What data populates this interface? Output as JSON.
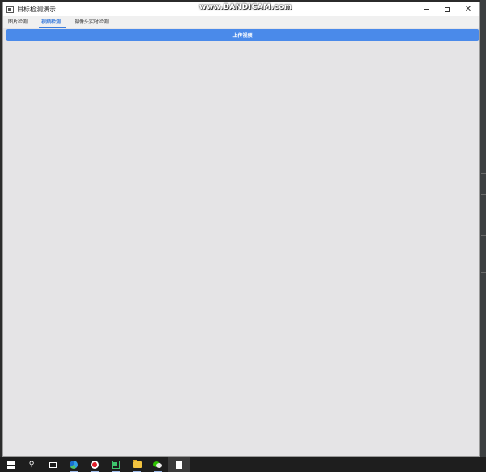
{
  "window": {
    "title": "目标检测演示",
    "watermark": "www.BANDICAM.com",
    "controls": {
      "minimize": "—",
      "maximize": "☐",
      "close": "✕"
    }
  },
  "tabs": [
    {
      "label": "图片检测",
      "active": false
    },
    {
      "label": "视频检测",
      "active": true
    },
    {
      "label": "摄像头实时检测",
      "active": false
    }
  ],
  "main": {
    "upload_button_label": "上传视频"
  },
  "taskbar": {
    "items": [
      {
        "icon": "windows-start-icon"
      },
      {
        "icon": "search-icon"
      },
      {
        "icon": "task-view-icon"
      },
      {
        "icon": "edge-browser-icon"
      },
      {
        "icon": "bandicam-record-icon"
      },
      {
        "icon": "pycharm-icon"
      },
      {
        "icon": "file-explorer-icon"
      },
      {
        "icon": "wechat-icon"
      },
      {
        "icon": "document-icon"
      }
    ]
  },
  "colors": {
    "accent": "#4a8aea",
    "tab_active": "#3f7fdc",
    "window_bg": "#e5e4e6",
    "taskbar_bg": "#1e1e1e"
  }
}
